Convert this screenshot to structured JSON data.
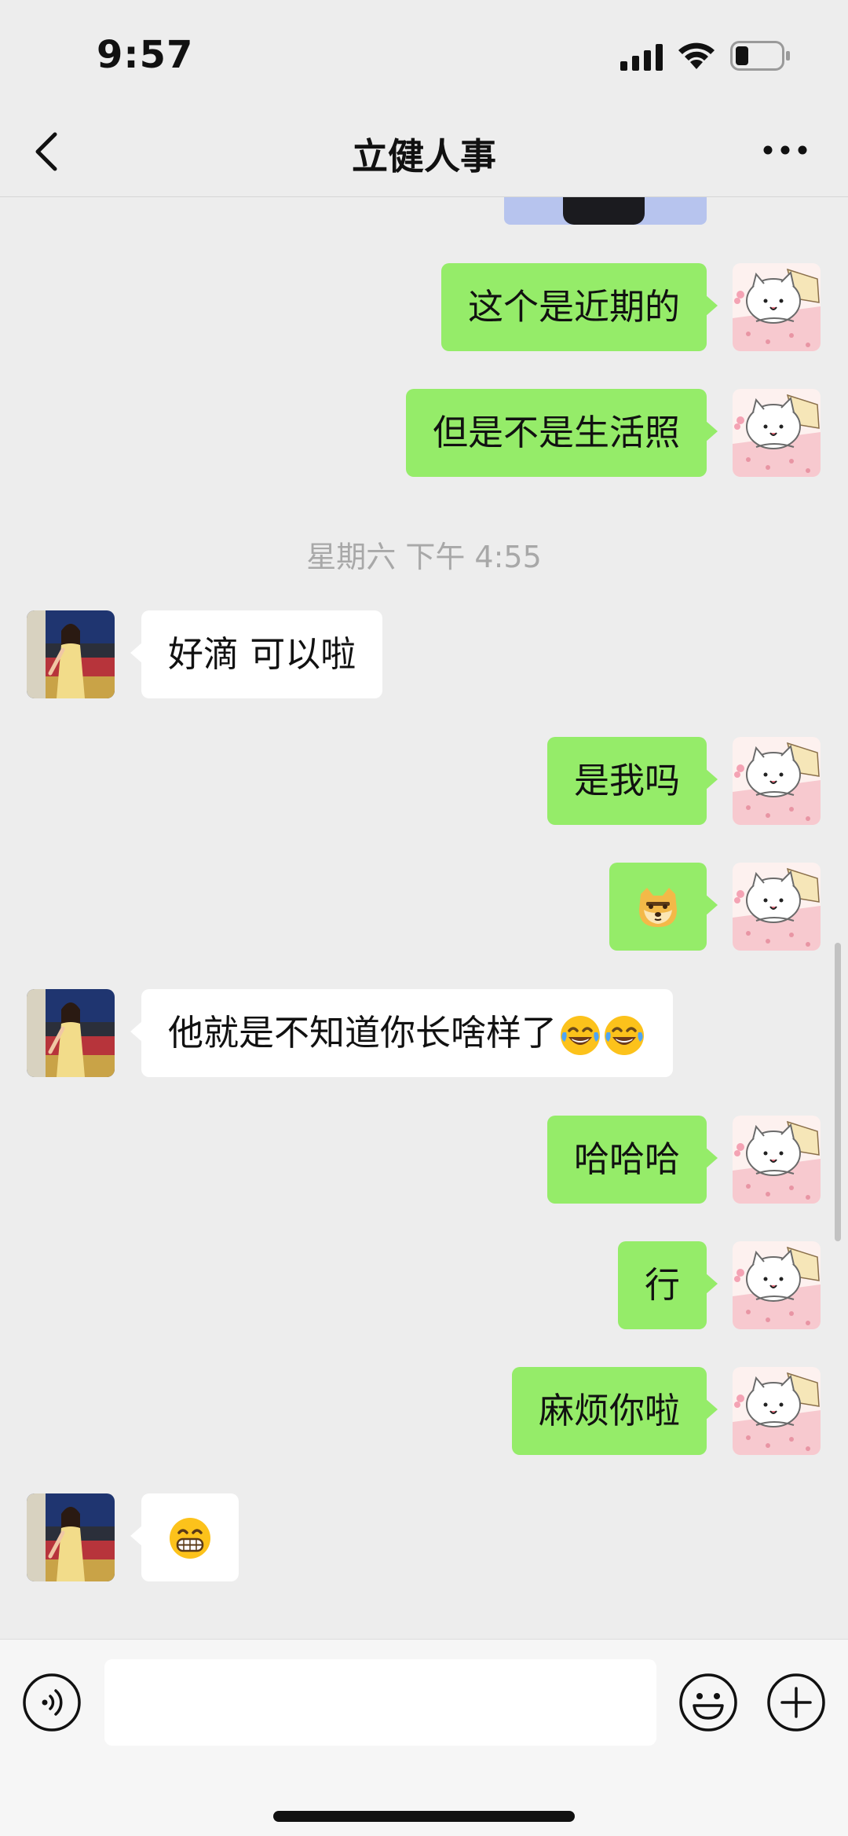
{
  "status_bar": {
    "time": "9:57",
    "battery_level": 0.25
  },
  "header": {
    "title": "立健人事"
  },
  "messages": [
    {
      "from": "me",
      "text": "这个是近期的"
    },
    {
      "from": "me",
      "text": "但是不是生活照"
    },
    {
      "timestamp": "星期六 下午 4:55"
    },
    {
      "from": "contact",
      "text": "好滴  可以啦"
    },
    {
      "from": "me",
      "text": "是我吗"
    },
    {
      "from": "me",
      "icon": "doge-face-icon"
    },
    {
      "from": "contact",
      "text": "他就是不知道你长啥样了",
      "icons": [
        "tears-of-joy-icon",
        "tears-of-joy-icon"
      ]
    },
    {
      "from": "me",
      "text": "哈哈哈"
    },
    {
      "from": "me",
      "text": "行"
    },
    {
      "from": "me",
      "text": "麻烦你啦"
    },
    {
      "from": "contact",
      "icon": "grinning-face-icon"
    }
  ],
  "colors": {
    "background": "#ededed",
    "outgoing_bubble": "#95ec69",
    "incoming_bubble": "#ffffff",
    "timestamp_text": "#a8a8a8"
  },
  "input_bar": {
    "voice_icon": "voice-icon",
    "emoji_icon": "smiley-icon",
    "plus_icon": "plus-icon"
  }
}
